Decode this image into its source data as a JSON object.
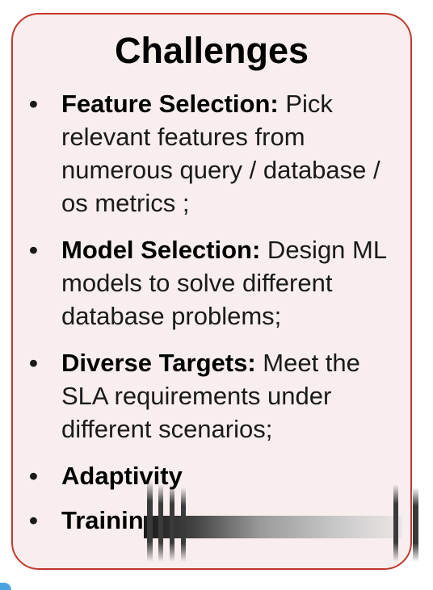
{
  "card": {
    "title": "Challenges",
    "items": [
      {
        "bullet": "•",
        "term": "Feature Selection:",
        "text": " Pick relevant features from numerous query / database / os metrics ;"
      },
      {
        "bullet": "•",
        "term": "Model Selection:",
        "text": " Design ML models to solve different database problems;"
      },
      {
        "bullet": "•",
        "term": "Diverse Targets:",
        "text": " Meet the SLA requirements under different scenarios;"
      },
      {
        "bullet": "•",
        "term": "Adaptivity",
        "text": ""
      },
      {
        "bullet": "•",
        "term": "Trainin",
        "text": ""
      }
    ]
  },
  "colors": {
    "border": "#c0392b",
    "background": "#f9eeee",
    "accent_corner": "#4aa3df"
  }
}
